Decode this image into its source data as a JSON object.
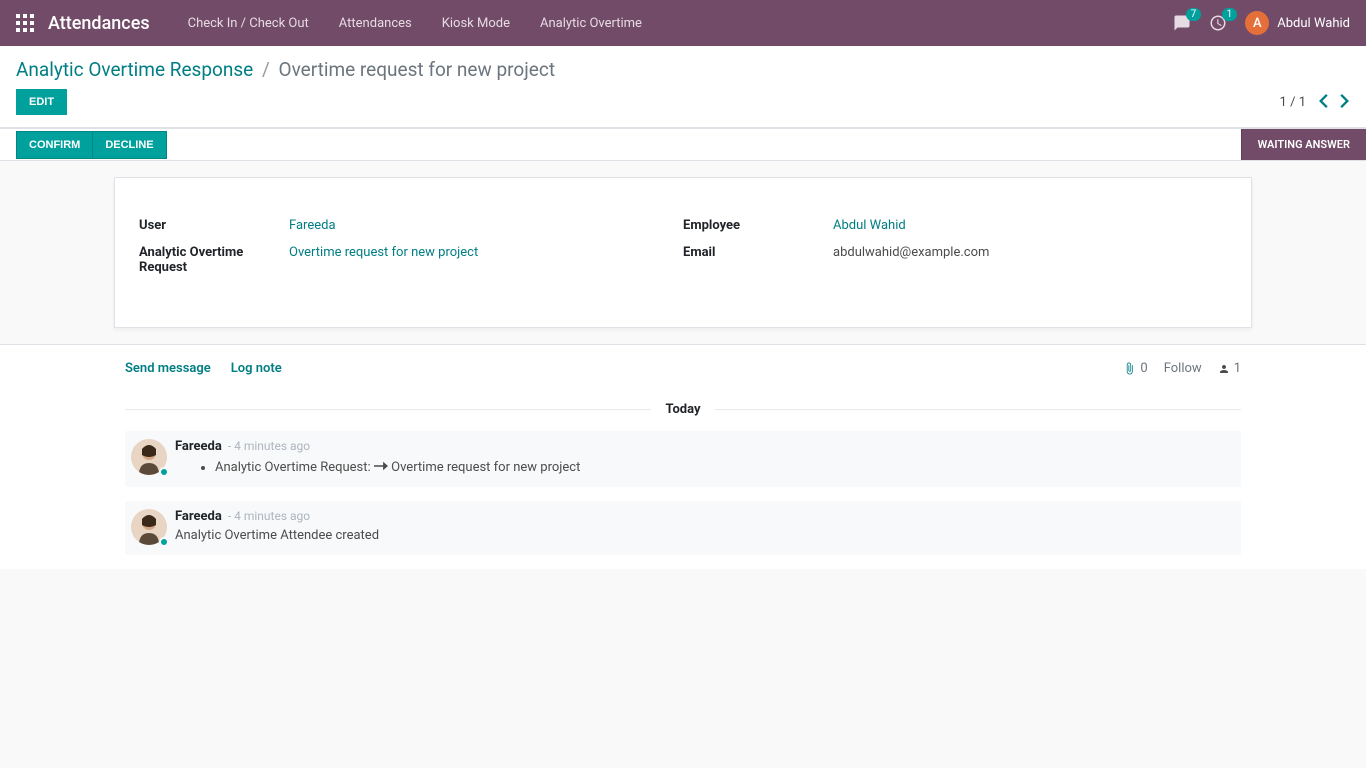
{
  "navbar": {
    "brand": "Attendances",
    "links": [
      {
        "label": "Check In / Check Out"
      },
      {
        "label": "Attendances"
      },
      {
        "label": "Kiosk Mode"
      },
      {
        "label": "Analytic Overtime"
      }
    ],
    "messaging_badge": "7",
    "activity_badge": "1",
    "user_initial": "A",
    "user_name": "Abdul Wahid"
  },
  "breadcrumb": {
    "parent": "Analytic Overtime Response",
    "current": "Overtime request for new project"
  },
  "buttons": {
    "edit": "Edit",
    "confirm": "Confirm",
    "decline": "Decline"
  },
  "pager": {
    "current": "1",
    "total": "1"
  },
  "status": "Waiting Answer",
  "form": {
    "labels": {
      "user": "User",
      "request": "Analytic Overtime Request",
      "employee": "Employee",
      "email": "Email"
    },
    "values": {
      "user": "Fareeda",
      "request": "Overtime request for new project",
      "employee": "Abdul Wahid",
      "email": "abdulwahid@example.com"
    }
  },
  "chatter": {
    "send_message": "Send message",
    "log_note": "Log note",
    "attachment_count": "0",
    "follow": "Follow",
    "follower_count": "1",
    "today": "Today",
    "messages": [
      {
        "author": "Fareeda",
        "time": "4 minutes ago",
        "tracking_label": "Analytic Overtime Request:",
        "tracking_new": "Overtime request for new project"
      },
      {
        "author": "Fareeda",
        "time": "4 minutes ago",
        "body": "Analytic Overtime Attendee created"
      }
    ]
  }
}
